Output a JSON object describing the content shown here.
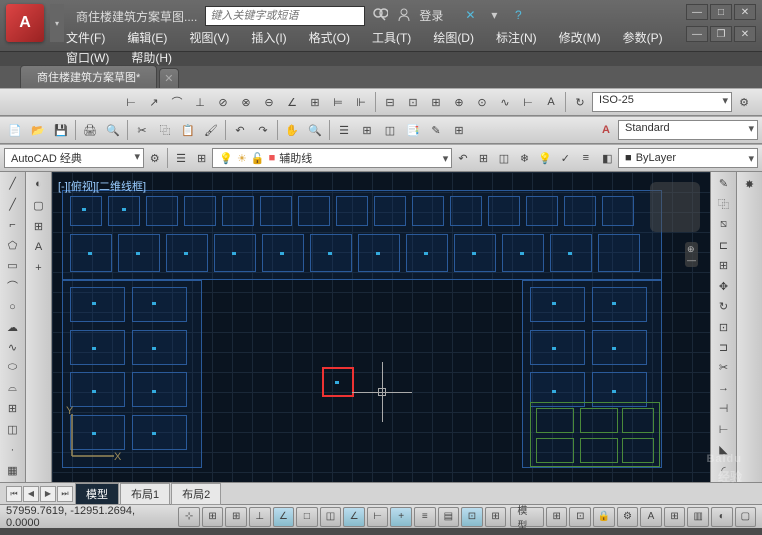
{
  "title": "商住楼建筑方案草图....",
  "search_placeholder": "键入关键字或短语",
  "login": "登录",
  "menus": [
    "文件(F)",
    "编辑(E)",
    "视图(V)",
    "插入(I)",
    "格式(O)",
    "工具(T)",
    "绘图(D)",
    "标注(N)",
    "修改(M)",
    "参数(P)"
  ],
  "menus2": [
    "窗口(W)",
    "帮助(H)"
  ],
  "file_tab": "商住楼建筑方案草图*",
  "workspace": "AutoCAD 经典",
  "layer_name": "辅助线",
  "dimstyle": "ISO-25",
  "textstyle": "Standard",
  "bylayer": "ByLayer",
  "view_label": "[-][俯视][二维线框]",
  "layout_tabs": [
    "模型",
    "布局1",
    "布局2"
  ],
  "coords": "57959.7619, -12951.2694, 0.0000",
  "status_model": "模型",
  "watermark": "Baidu",
  "watermark_sub": "经验"
}
